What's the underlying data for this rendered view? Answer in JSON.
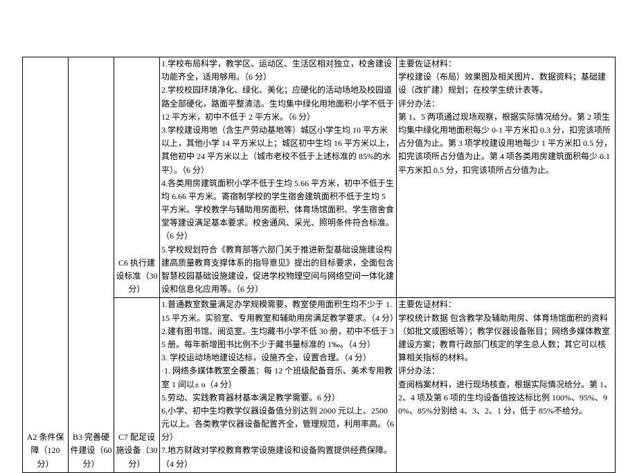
{
  "col1": "A2 条件保障（120 分）",
  "col2": "B3 完善硬件建设（60 分）",
  "row1": {
    "c3": "C6 执行建设标准（30 分）",
    "c4": [
      "1.学校布局科学，教学区、运动区、生活区相对独立，校舍建设功能齐全，适用够用。（6 分）",
      "2.学校校园环境净化、绿化、美化；应硬化的活动场地及校园道路全部硬化，路面平整清洁。生均集中绿化用地面积小学不低于 12 平方米，初中不低于 2 平方米。（6 分）",
      "3.学校建设用地（含生产劳动基地等）城区小学生均 10 平方米以上，其他小学 14 平方米以上；城区初中生均 16 平方米以上，其他初中 24 平方米以上（城市老校不低于上述标准的 85%的水平）。（6 分）",
      "4.各类用房建筑面积小学不低于生均 5.66 平方米，初中不低于生均 6.66 平方米。寄宿制学校的学生宿舍建筑面积不低于生均 5 平方米。学校教学与辅助用房面积、体育场馆面积、学生宿舍食堂等建设满足基本要求。校舍通风、采光、照明条件符合标准。（6 分）",
      "5.学校规划符合《教育部等六部门关于推进新型基础设施建设构建高质量教育支撑体系的指导意见》提出的目标要求，全面包含智慧校园基础设施建设，促进学校物理空间与网络空间一体化建设和信息化应用等。（6 分）"
    ],
    "c5": [
      "主要佐证材料：",
      "学校建设（布局）效果图及相关图片、数据资料；基础建设（改扩建）规划；在校学生统计表等。",
      "评分办法：",
      "第 1、5 两项通过现场观察，根据实际情况给分。第 2 项生均集中绿化用地面积每少 0-1 平方米扣 0.3 分，扣完该项所占分值为止。第 3 项学校建设用地每少 1 平方米扣 0.5 分，扣完该项所占分值为止。第 4 项各类用房建筑面积每少 0.1 平方米扣 0.5 分，扣完该项所占分值为止。"
    ]
  },
  "row2": {
    "c3": "C7 配足设施设备（30 分）",
    "c4": [
      "1.普通教室数量满足办学规模需要，教室使用面积生均不少于 1.15 平方米。实验室、专用教室和辅助用房满足教学要求。（4 分）",
      "2.建有图书馆、阅览室。生均藏书小学不低 30 册，初中不低于 35 册。每年新增图书比例不少于藏书量标准的 1‰。（4 分）",
      "3. 学校运动场地建设达标，设施齐全，设置合理。（4 分）",
      "·1. 网络多媒体教室全覆盖：每 12 个班级配备音乐、美术专用教室 1 间以± o（4 分）",
      "5.劳动、实践教育器材基本满足教学需要。6 分）",
      "6.小学、初中生均教学仪器设备值分别达到 2000 元以上、2500 元以上。各类教学仪器设备配置齐全，管理规范，利用率高。（6 分）",
      "7.地方财政对学校教育教学设施建设和设备购置提供经费保障。（4 分）"
    ],
    "c5": [
      "主要佐证材料：",
      "学校统计数据 包含教学及辅助用房、体育场馆面积的资料（如批文或图纸等）；教学仪器设备账目；网络多媒体教室建设方案；教育行政部门核定的学生总人数；其它可以核算相关指标的材料。",
      "评分办法：",
      "查阅档案材料，进行现场核查，根据实际情况给分。第 1、2、4 项及第 6 项的生均设备值按达标比例 100%、95%、90%、85%分别给 4、3、2、1 分，低于 85%不给分。"
    ]
  }
}
